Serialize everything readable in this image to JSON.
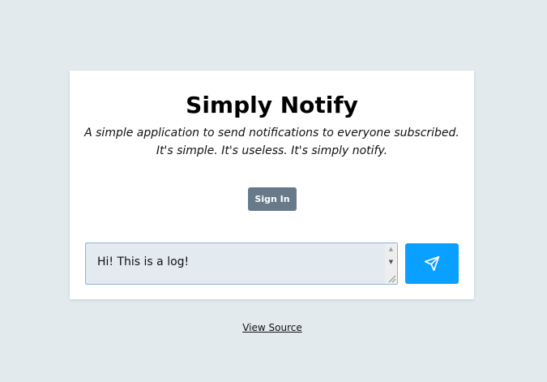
{
  "app": {
    "title": "Simply Notify",
    "subtitle_line1": "A simple application to send notifications to everyone subscribed.",
    "subtitle_line2": "It's simple. It's useless. It's simply notify."
  },
  "auth": {
    "signin_label": "Sign In"
  },
  "composer": {
    "message_value": "Hi! This is a log!",
    "send_icon": "paper-plane-icon"
  },
  "footer": {
    "view_source_label": "View Source"
  },
  "colors": {
    "background": "#e3eaee",
    "card": "#ffffff",
    "signin_button": "#687a8a",
    "send_button": "#0aa0ff",
    "input_border": "#8fb2d8"
  }
}
